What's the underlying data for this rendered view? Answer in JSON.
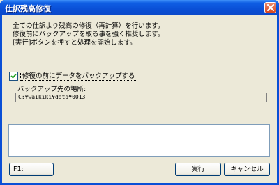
{
  "window": {
    "title": "仕訳残高修復",
    "close_icon": "close-icon"
  },
  "description": {
    "line1": "全ての仕訳より残高の修復（再計算）を行います。",
    "line2": "修復前にバックアップを取る事を強く推奨します。",
    "line3": "[実行]ボタンを押すと処理を開始します。"
  },
  "backup": {
    "checkbox_label": "修復の前にデータをバックアップする",
    "checked": true,
    "location_label": "バックアップ先の場所:",
    "location_value": "C:¥waikiki¥data¥0013"
  },
  "log": {
    "content": ""
  },
  "buttons": {
    "f1_label": "F1:",
    "execute_label": "実行",
    "cancel_label": "キャンセル"
  }
}
